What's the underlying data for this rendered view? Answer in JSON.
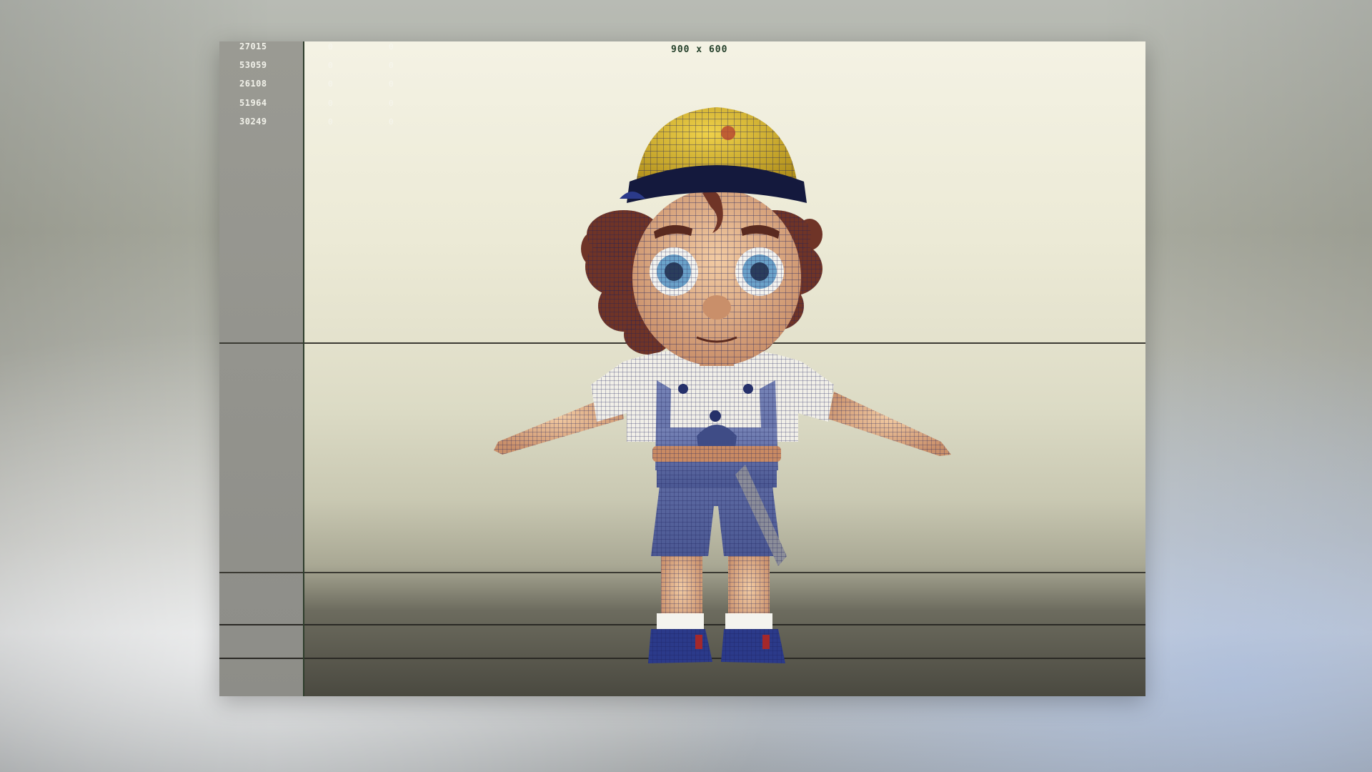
{
  "viewport": {
    "resolution_label": "900 x 600"
  },
  "stats": {
    "rows": [
      {
        "value": "27015",
        "col1": "0",
        "col2": "0"
      },
      {
        "value": "53059",
        "col1": "0",
        "col2": "0"
      },
      {
        "value": "26108",
        "col1": "0",
        "col2": "0"
      },
      {
        "value": "51964",
        "col1": "0",
        "col2": "0"
      },
      {
        "value": "30249",
        "col1": "0",
        "col2": "0"
      }
    ]
  },
  "colors": {
    "helmet": "#d9b92e",
    "helmet_band": "#14193d",
    "hair": "#6b3226",
    "skin": "#e8b88d",
    "shirt": "#f1efe8",
    "overalls": "#5e6fa6",
    "belt": "#c98a63",
    "shoes": "#2b3a8a",
    "wireframe": "#1b1f5a"
  },
  "icons": [
    "character-model-icon"
  ]
}
